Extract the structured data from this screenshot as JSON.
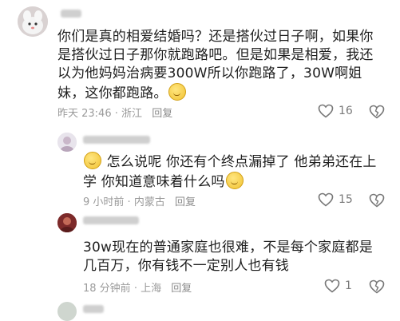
{
  "comments": [
    {
      "text_lines": [
        "你们是真的相爱结婚吗？还是搭伙过日子啊，如果你",
        "是搭伙过日子那你就跑路吧。但是如果是相爱，我还",
        "以为他妈妈治病要300W所以你跑路了，30W啊姐",
        "妹，这你都跑路。"
      ],
      "time": "昨天 23:46",
      "location": "浙江",
      "reply_label": "回复",
      "likes": "16"
    },
    {
      "text_lines": [
        "怎么说呢 你还有个终点漏掉了 他弟弟还在上",
        "学 你知道意味着什么吗"
      ],
      "time": "9 小时前",
      "location": "内蒙古",
      "reply_label": "回复",
      "likes": "15"
    },
    {
      "text_lines": [
        "30w现在的普通家庭也很难，不是每个家庭都是",
        "几百万，你有钱不一定别人也有钱"
      ],
      "time": "18 分钟前",
      "location": "上海",
      "reply_label": "回复",
      "likes": "1"
    }
  ],
  "icons": {
    "like": "heart-outline-icon",
    "dislike": "broken-heart-icon",
    "emoji": "smiling-face-icon"
  },
  "separator": "·"
}
